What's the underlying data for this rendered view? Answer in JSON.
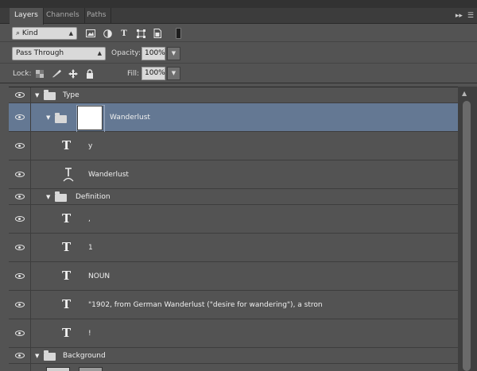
{
  "tabs": [
    "Layers",
    "Channels",
    "Paths"
  ],
  "panel_menu": {
    "collapse": "▸▸",
    "menu": "☰"
  },
  "filter": {
    "kind_label": "Kind",
    "icons": [
      "image-filter-icon",
      "adjustment-filter-icon",
      "type-filter-icon",
      "shape-filter-icon",
      "smart-object-filter-icon"
    ]
  },
  "blend": {
    "mode": "Pass Through",
    "opacity_label": "Opacity:",
    "opacity": "100%",
    "fill_label": "Fill:",
    "fill": "100%"
  },
  "lock": {
    "label": "Lock:",
    "icons": [
      "lock-transparent-icon",
      "lock-image-icon",
      "lock-position-icon",
      "lock-all-icon"
    ]
  },
  "layers": [
    {
      "name": "Type",
      "kind": "group"
    },
    {
      "name": "Wanderlust",
      "kind": "smart"
    },
    {
      "name": "y",
      "kind": "text"
    },
    {
      "name": "Wanderlust",
      "kind": "warptext"
    },
    {
      "name": "Definition",
      "kind": "group"
    },
    {
      "name": ",",
      "kind": "text"
    },
    {
      "name": "1",
      "kind": "text"
    },
    {
      "name": "NOUN",
      "kind": "text"
    },
    {
      "name": "\"1902, from German Wanderlust (\"desire for wandering\"), a stron",
      "kind": "text"
    },
    {
      "name": "!",
      "kind": "text"
    },
    {
      "name": "Background",
      "kind": "group"
    }
  ],
  "colors": {
    "panel": "#535353",
    "selected_row": "#647893",
    "tabbar": "#3c3c3c"
  }
}
